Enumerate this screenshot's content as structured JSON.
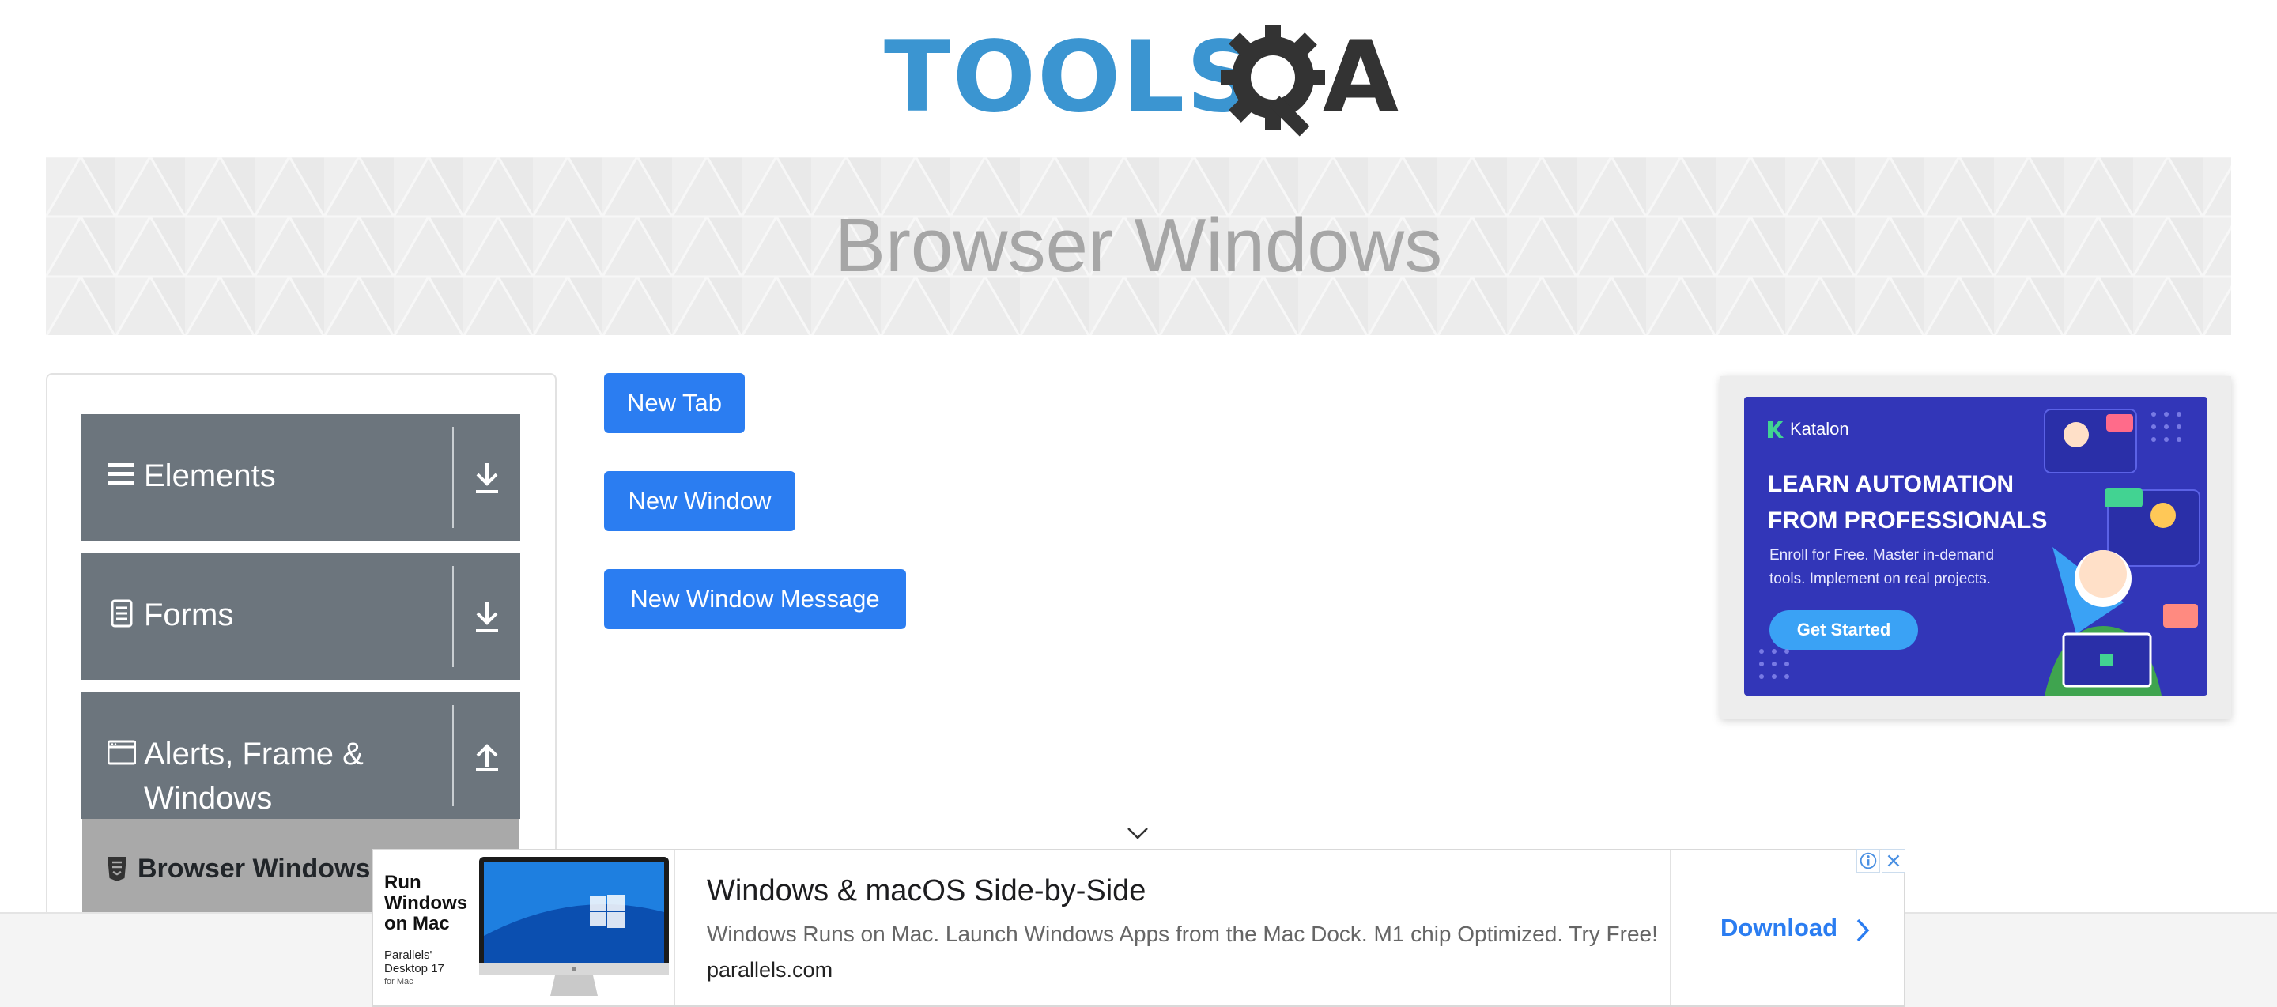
{
  "header": {
    "logo_text": "TOOLS",
    "logo_suffix": "A",
    "logo_icon": "gear-q-icon"
  },
  "banner": {
    "title": "Browser Windows"
  },
  "sidebar": {
    "groups": [
      {
        "label": "Elements",
        "icon": "hamburger-icon",
        "arrow": "download-arrow-icon"
      },
      {
        "label": "Forms",
        "icon": "document-icon",
        "arrow": "download-arrow-icon"
      },
      {
        "label": "Alerts, Frame & Windows",
        "icon": "window-icon",
        "arrow": "upload-arrow-icon"
      }
    ],
    "active_item": {
      "label": "Browser Windows",
      "icon": "html5-icon"
    }
  },
  "buttons": {
    "new_tab": "New Tab",
    "new_window": "New Window",
    "new_window_message": "New Window Message"
  },
  "ad_right": {
    "brand": "Katalon",
    "headline_line1": "LEARN AUTOMATION",
    "headline_line2": "FROM PROFESSIONALS",
    "subtext": "Enroll for Free. Master in-demand tools. Implement on real projects.",
    "cta": "Get Started"
  },
  "ad_bottom": {
    "thumb_text": "Run Windows on Mac",
    "thumb_brand": "Parallels' Desktop 17",
    "thumb_brand_sub": "for Mac",
    "title": "Windows & macOS Side-by-Side",
    "description": "Windows Runs on Mac. Launch Windows Apps from the Mac Dock. M1 chip Optimized. Try Free!",
    "url": "parallels.com",
    "cta": "Download"
  },
  "colors": {
    "primary_button": "#2b7df1",
    "sidebar_group": "#6c757d",
    "active_item": "#a9a9a9",
    "katalon_bg": "#3236b8",
    "logo_blue": "#3b95d1"
  }
}
